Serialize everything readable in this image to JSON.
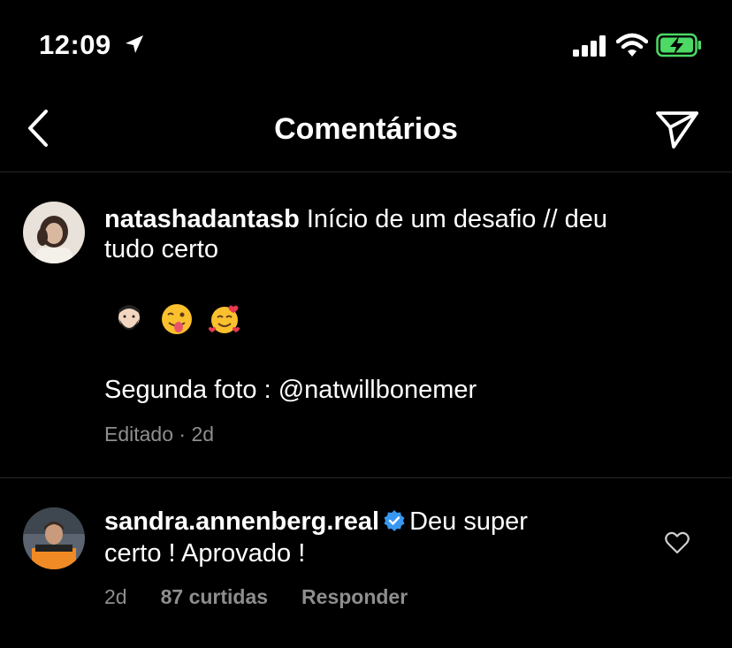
{
  "status_bar": {
    "time": "12:09",
    "icons": [
      "location-arrow-icon",
      "signal-icon",
      "wifi-icon",
      "battery-charging-icon"
    ],
    "battery_color": "#4cd964"
  },
  "header": {
    "title": "Comentários",
    "back_icon": "chevron-left-icon",
    "share_icon": "paper-plane-icon"
  },
  "caption": {
    "username": "natashadantasb",
    "text_line1": " Início de um desafio // deu",
    "text_line2": "tudo certo",
    "emojis": [
      "man-beard-emoji",
      "winking-tongue-emoji",
      "smiling-hearts-emoji"
    ],
    "second_line": "Segunda foto : @natwillbonemer",
    "meta": "Editado · 2d"
  },
  "comment": {
    "username": "sandra.annenberg.real",
    "verified": true,
    "text_line1": "Deu super",
    "text_line2": "certo ! Aprovado !",
    "time": "2d",
    "likes": "87 curtidas",
    "reply": "Responder"
  },
  "colors": {
    "background": "#000000",
    "text": "#ffffff",
    "muted": "#8e8e8e",
    "verified_blue": "#3897f0",
    "divider": "#262626"
  }
}
